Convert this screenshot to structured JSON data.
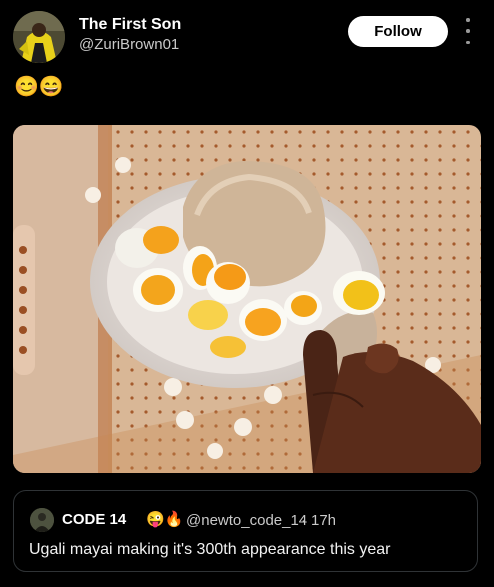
{
  "post": {
    "author_name": "The First Son",
    "author_handle": "@ZuriBrown01",
    "follow_label": "Follow",
    "text": "😊😄"
  },
  "quote": {
    "author_name": "CODE 14",
    "author_emojis": "😜🔥",
    "author_handle": "@newto_code_14",
    "separator": "·",
    "time": "17h",
    "text": "Ugali mayai making it's 300th appearance this year"
  },
  "icons": {
    "more": "more-vertical-icon"
  },
  "colors": {
    "background": "#000000",
    "follow_button": "#ffffff",
    "secondary_text": "#c9c9c9",
    "border": "#2f3336"
  }
}
